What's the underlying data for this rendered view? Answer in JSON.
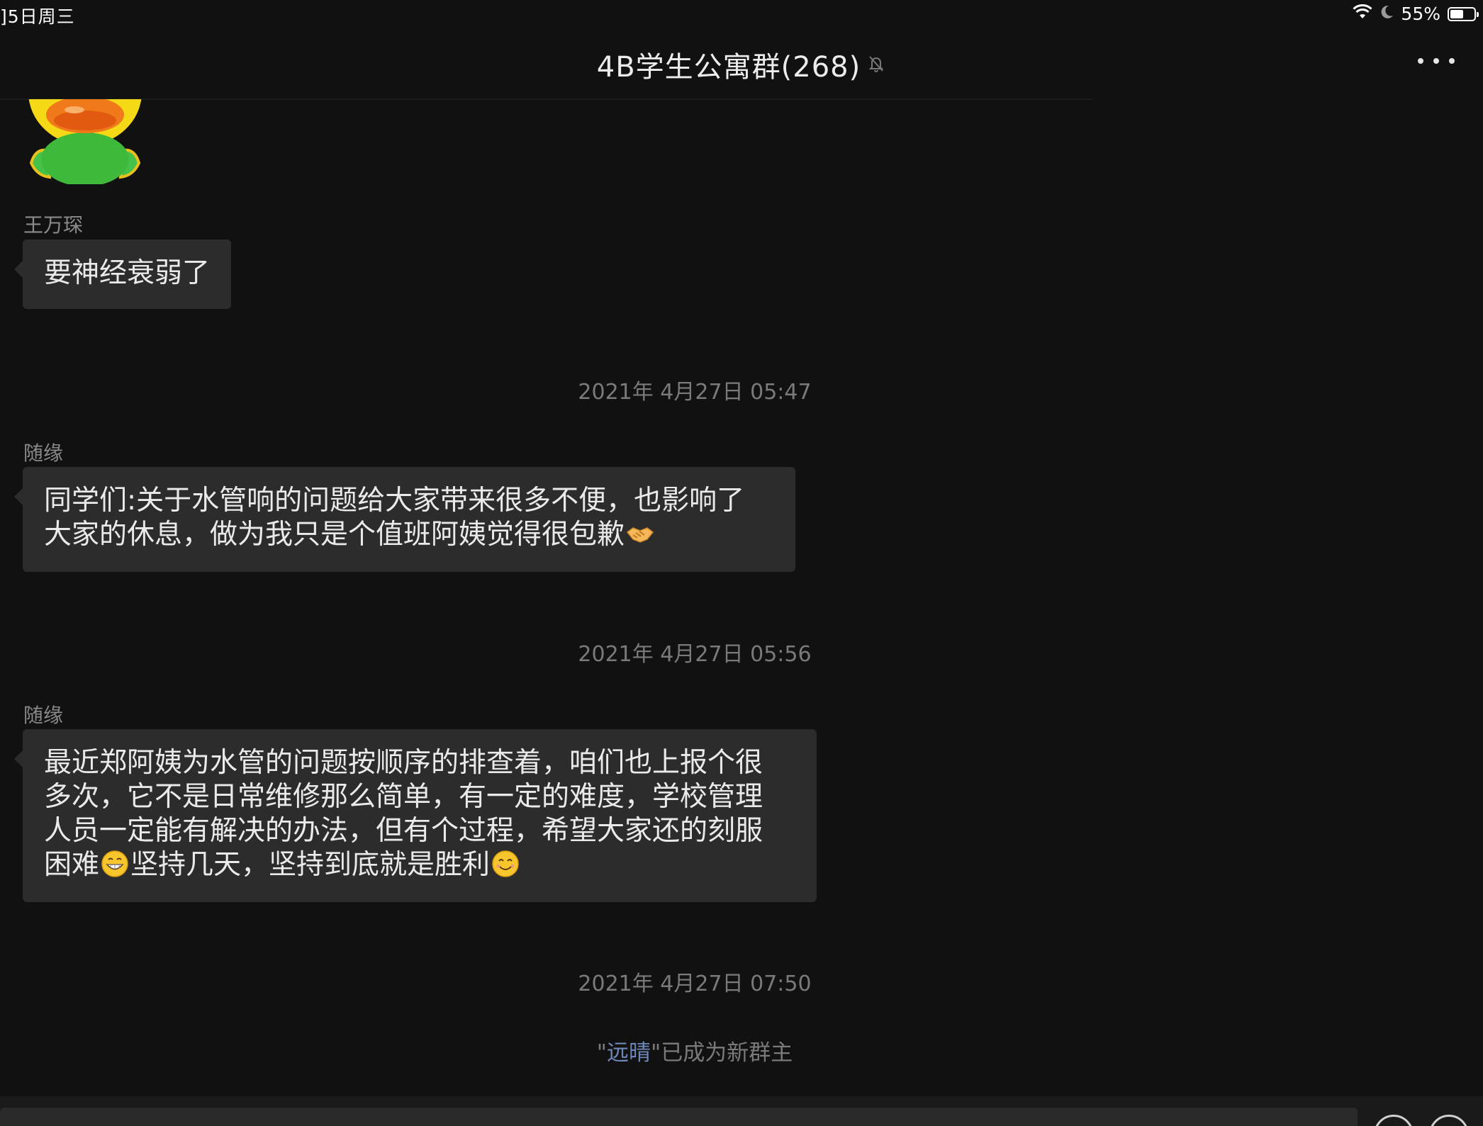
{
  "status_bar": {
    "date": "]5日周三",
    "battery": "55%",
    "battery_level": 0.55
  },
  "header": {
    "title": "4B学生公寓群(268)",
    "muted_icon": "bell-slash-icon",
    "more_icon": "ellipsis-icon"
  },
  "messages": [
    {
      "sender": "王万琛",
      "text": "要神经衰弱了"
    },
    {
      "timestamp": "2021年 4月27日 05:47",
      "sender": "随缘",
      "lines": [
        "同学们:关于水管响的问题给大家带来很多不便，也影响了",
        "大家的休息，做为我只是个值班阿姨觉得很包歉"
      ],
      "emoji": "handshake-emoji"
    },
    {
      "timestamp": "2021年 4月27日 05:56",
      "sender": "随缘",
      "lines": [
        "最近郑阿姨为水管的问题按顺序的排查着，咱们也上报个很",
        "多次，它不是日常维修那么简单，有一定的难度，学校管理",
        "人员一定能有解决的办法，但有个过程，希望大家还的刻服"
      ],
      "last_line_parts": [
        "困难",
        "坚持几天，坚持到底就是胜利"
      ],
      "emojis": [
        "grin-emoji",
        "smile-emoji"
      ]
    }
  ],
  "system": {
    "timestamp": "2021年 4月27日 07:50",
    "quote_open": "\"",
    "name": "远晴",
    "suffix": "\"已成为新群主"
  },
  "colors": {
    "background": "#111111",
    "bubble": "#2c2c2c",
    "link": "#6f88b8",
    "muted_text": "#7a7a7a"
  }
}
